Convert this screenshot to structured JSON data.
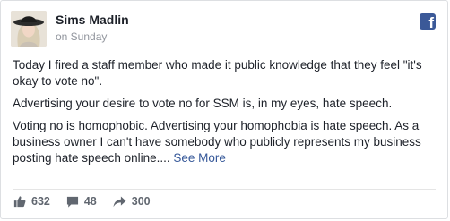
{
  "post": {
    "author": "Sims Madlin",
    "time": "on Sunday",
    "paragraphs": [
      "Today I fired a staff member who made it public knowledge that they feel \"it's okay to vote no\".",
      "Advertising your desire to vote no for SSM is, in my eyes, hate speech."
    ],
    "last_paragraph": "Voting no is homophobic. Advertising your homophobia is hate speech. As a business owner I can't have somebody who publicly represents my business posting hate speech online....",
    "see_more": "See More"
  },
  "stats": {
    "likes": "632",
    "comments": "48",
    "shares": "300"
  },
  "icons": {
    "brand": "facebook-logo-icon",
    "brand_glyph": "f",
    "like": "thumbs-up-icon",
    "comment": "comment-bubble-icon",
    "share": "share-arrow-icon"
  },
  "colors": {
    "brand": "#3b5998",
    "link": "#365899",
    "muted": "#90949c",
    "stat": "#616770"
  }
}
